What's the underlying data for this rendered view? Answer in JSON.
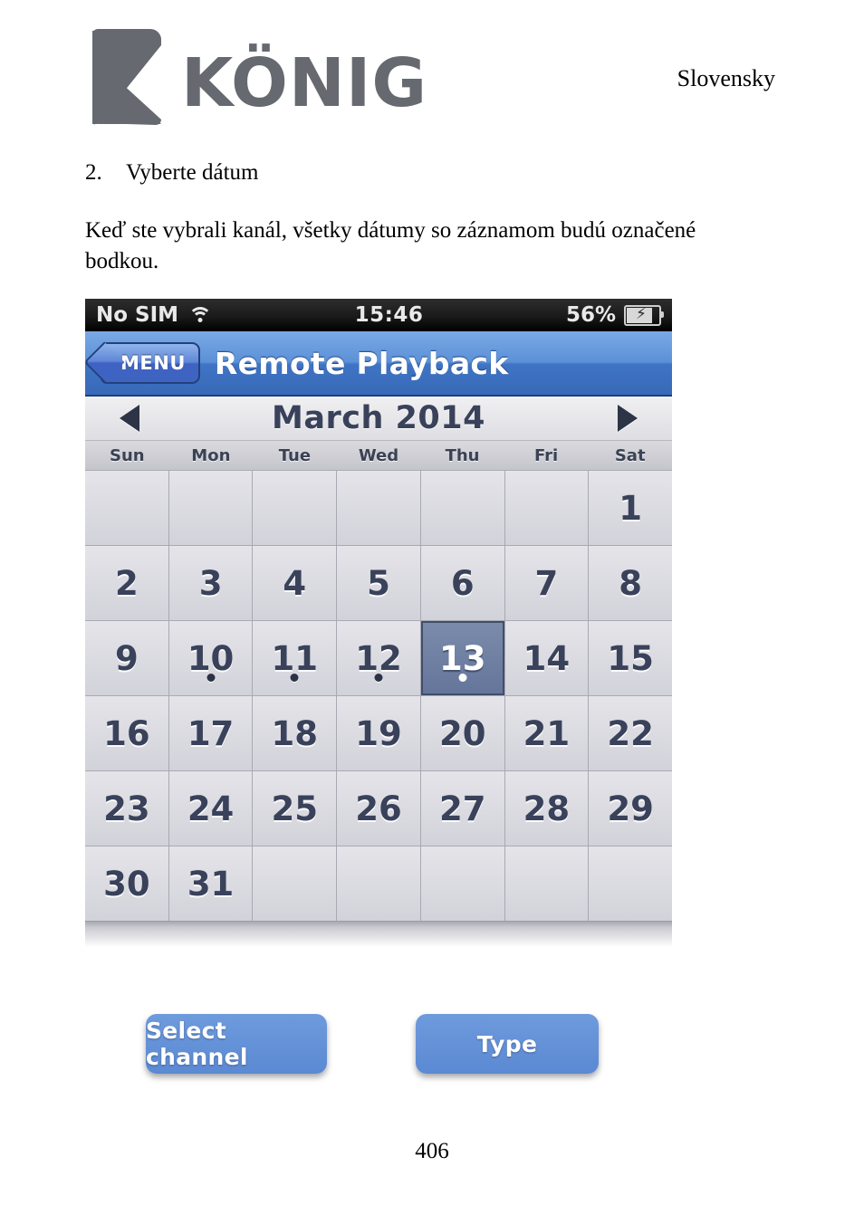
{
  "document": {
    "language_label": "Slovensky",
    "page_number": "406",
    "logo_text": "KÖNIG",
    "step": {
      "number": "2.",
      "text": "Vyberte dátum"
    },
    "paragraph": "Keď ste vybrali kanál, všetky dátumy so záznamom budú označené bodkou."
  },
  "phone": {
    "status_bar": {
      "carrier": "No SIM",
      "wifi_icon": "wifi-icon",
      "time": "15:46",
      "battery_percent": "56%",
      "battery_icon": "battery-charging-icon"
    },
    "nav_bar": {
      "back_label": "MENU",
      "title": "Remote Playback",
      "accent_color": "#3f74c4"
    },
    "calendar": {
      "prev_icon": "triangle-left-icon",
      "next_icon": "triangle-right-icon",
      "month_label": "March 2014",
      "weekdays": [
        "Sun",
        "Mon",
        "Tue",
        "Wed",
        "Thu",
        "Fri",
        "Sat"
      ],
      "selected_day": "13",
      "selected_color": "#64759a",
      "dot_days": [
        "10",
        "11",
        "12",
        "13"
      ],
      "weeks": [
        [
          {
            "day": "",
            "dot": false,
            "selected": false
          },
          {
            "day": "",
            "dot": false,
            "selected": false
          },
          {
            "day": "",
            "dot": false,
            "selected": false
          },
          {
            "day": "",
            "dot": false,
            "selected": false
          },
          {
            "day": "",
            "dot": false,
            "selected": false
          },
          {
            "day": "",
            "dot": false,
            "selected": false
          },
          {
            "day": "1",
            "dot": false,
            "selected": false
          }
        ],
        [
          {
            "day": "2",
            "dot": false,
            "selected": false
          },
          {
            "day": "3",
            "dot": false,
            "selected": false
          },
          {
            "day": "4",
            "dot": false,
            "selected": false
          },
          {
            "day": "5",
            "dot": false,
            "selected": false
          },
          {
            "day": "6",
            "dot": false,
            "selected": false
          },
          {
            "day": "7",
            "dot": false,
            "selected": false
          },
          {
            "day": "8",
            "dot": false,
            "selected": false
          }
        ],
        [
          {
            "day": "9",
            "dot": false,
            "selected": false
          },
          {
            "day": "10",
            "dot": true,
            "selected": false
          },
          {
            "day": "11",
            "dot": true,
            "selected": false
          },
          {
            "day": "12",
            "dot": true,
            "selected": false
          },
          {
            "day": "13",
            "dot": true,
            "selected": true
          },
          {
            "day": "14",
            "dot": false,
            "selected": false
          },
          {
            "day": "15",
            "dot": false,
            "selected": false
          }
        ],
        [
          {
            "day": "16",
            "dot": false,
            "selected": false
          },
          {
            "day": "17",
            "dot": false,
            "selected": false
          },
          {
            "day": "18",
            "dot": false,
            "selected": false
          },
          {
            "day": "19",
            "dot": false,
            "selected": false
          },
          {
            "day": "20",
            "dot": false,
            "selected": false
          },
          {
            "day": "21",
            "dot": false,
            "selected": false
          },
          {
            "day": "22",
            "dot": false,
            "selected": false
          }
        ],
        [
          {
            "day": "23",
            "dot": false,
            "selected": false
          },
          {
            "day": "24",
            "dot": false,
            "selected": false
          },
          {
            "day": "25",
            "dot": false,
            "selected": false
          },
          {
            "day": "26",
            "dot": false,
            "selected": false
          },
          {
            "day": "27",
            "dot": false,
            "selected": false
          },
          {
            "day": "28",
            "dot": false,
            "selected": false
          },
          {
            "day": "29",
            "dot": false,
            "selected": false
          }
        ],
        [
          {
            "day": "30",
            "dot": false,
            "selected": false
          },
          {
            "day": "31",
            "dot": false,
            "selected": false
          },
          {
            "day": "",
            "dot": false,
            "selected": false
          },
          {
            "day": "",
            "dot": false,
            "selected": false
          },
          {
            "day": "",
            "dot": false,
            "selected": false
          },
          {
            "day": "",
            "dot": false,
            "selected": false
          },
          {
            "day": "",
            "dot": false,
            "selected": false
          }
        ]
      ]
    },
    "buttons": {
      "select_channel": "Select channel",
      "type": "Type",
      "color": "#5b89d3"
    }
  }
}
